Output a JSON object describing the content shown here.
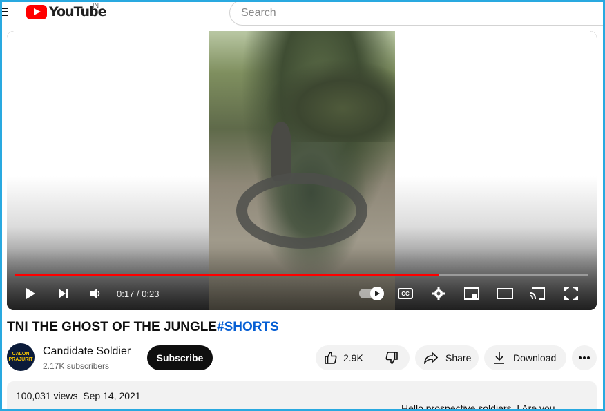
{
  "header": {
    "logo_text": "YouTube",
    "region": "IN",
    "search_placeholder": "Search"
  },
  "player": {
    "time_current": "0:17",
    "time_total": "0:23",
    "time_display": "0:17 / 0:23",
    "progress_fraction": 0.74,
    "cc_label": "CC",
    "accent_color": "#ff0000"
  },
  "video": {
    "title_main": "TNI THE GHOST OF THE JUNGLE",
    "title_hashtag": "#SHORTS"
  },
  "channel": {
    "avatar_line1": "CALON",
    "avatar_line2": "PRAJURIT",
    "name": "Candidate Soldier",
    "subscribers": "2.17K subscribers",
    "subscribe_label": "Subscribe"
  },
  "actions": {
    "like_count": "2.9K",
    "share_label": "Share",
    "download_label": "Download"
  },
  "description": {
    "views": "100,031 views",
    "date": "Sep 14, 2021",
    "snippet": "Hello prospective soldiers, I Are you"
  },
  "icons": {
    "menu": "menu-icon",
    "play": "play-icon",
    "next": "next-icon",
    "volume": "volume-icon",
    "settings": "gear-icon",
    "miniplayer": "miniplayer-icon",
    "theater": "theater-icon",
    "cast": "cast-icon",
    "fullscreen": "fullscreen-icon",
    "like": "thumbs-up-icon",
    "dislike": "thumbs-down-icon",
    "share": "share-icon",
    "download": "download-icon",
    "more": "more-icon"
  }
}
